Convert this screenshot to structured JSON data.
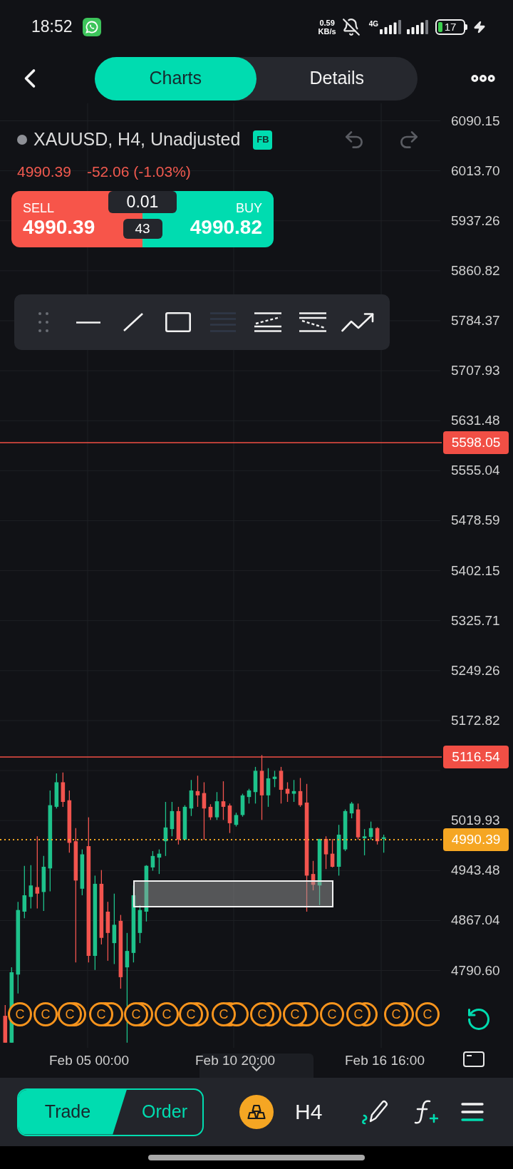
{
  "status_bar": {
    "time": "18:52",
    "speed": "0.59",
    "speed_unit": "KB/s",
    "network": "4G",
    "battery": "17"
  },
  "header": {
    "tabs": [
      {
        "label": "Charts",
        "selected": true
      },
      {
        "label": "Details",
        "selected": false
      }
    ]
  },
  "chart": {
    "symbol": "XAUUSD, H4, Unadjusted",
    "badge": "FB",
    "last_price": "4990.39",
    "change": "-52.06 (-1.03%)",
    "quote": {
      "sell_label": "SELL",
      "sell_price": "4990.39",
      "quantity": "0.01",
      "spread": "43",
      "buy_label": "BUY",
      "buy_price": "4990.82"
    },
    "drawing_tools": [
      {
        "disabled": false
      },
      {
        "disabled": false
      },
      {
        "disabled": false
      },
      {
        "disabled": true
      },
      {
        "disabled": false
      },
      {
        "disabled": false
      },
      {
        "disabled": false
      }
    ],
    "price_axis": [
      "6090.15",
      "6013.70",
      "5937.26",
      "5860.82",
      "5784.37",
      "5707.93",
      "5631.48",
      "5555.04",
      "5478.59",
      "5402.15",
      "5325.71",
      "5249.26",
      "5172.82",
      "5019.93",
      "4943.48",
      "4867.04",
      "4790.60"
    ],
    "price_lines": [
      {
        "label": "5598.05",
        "kind": "solid",
        "color": "#f14f45"
      },
      {
        "label": "5116.54",
        "kind": "solid",
        "color": "#f14f45"
      },
      {
        "label": "4990.39",
        "kind": "dotted",
        "color": "#f5a623"
      }
    ],
    "event_markers": [
      {
        "label": "C"
      },
      {
        "label": "C"
      },
      {
        "label": "C"
      },
      {
        "label": "C"
      },
      {
        "label": "C"
      },
      {
        "label": "C"
      },
      {
        "label": "C"
      },
      {
        "label": "C"
      },
      {
        "label": "C"
      },
      {
        "label": "C"
      },
      {
        "label": "C"
      },
      {
        "label": "C"
      },
      {
        "label": "C"
      },
      {
        "label": "C"
      }
    ],
    "time_axis": [
      "Feb 05 00:00",
      "Feb 10 20:00",
      "Feb 16 16:00"
    ]
  },
  "bottom_bar": {
    "actions": [
      {
        "label": "Trade",
        "selected": true
      },
      {
        "label": "Order",
        "selected": false
      }
    ],
    "timeframe": "H4"
  }
}
